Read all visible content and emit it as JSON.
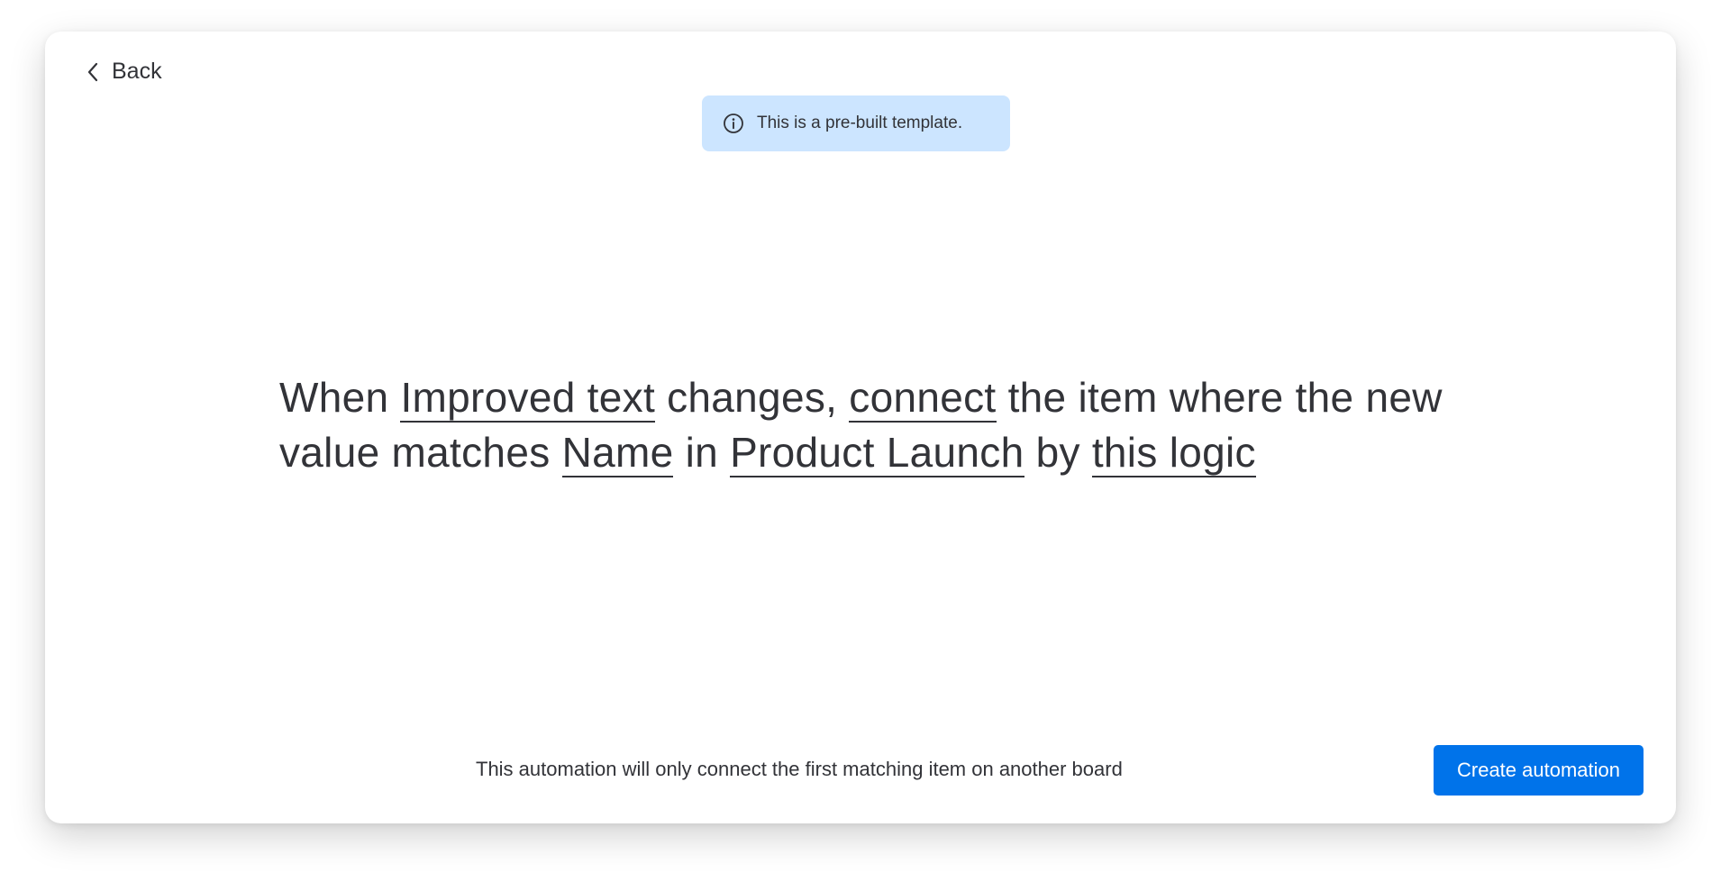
{
  "header": {
    "back_label": "Back"
  },
  "banner": {
    "text": "This is a pre-built template."
  },
  "sentence": {
    "part_1": "When ",
    "token_1": "Improved text",
    "part_2": " changes, ",
    "token_2": "connect",
    "part_3": " the item where the new value matches ",
    "token_3": "Name",
    "part_4": " in ",
    "token_4": "Product Launch",
    "part_5": " by ",
    "token_5": "this logic"
  },
  "footer": {
    "note": "This automation will only connect the first matching item on another board",
    "create_label": "Create automation"
  },
  "colors": {
    "accent": "#0073ea",
    "banner_bg": "#cce5ff",
    "text": "#323338"
  },
  "icons": {
    "back": "chevron-left-icon",
    "info": "info-icon"
  }
}
